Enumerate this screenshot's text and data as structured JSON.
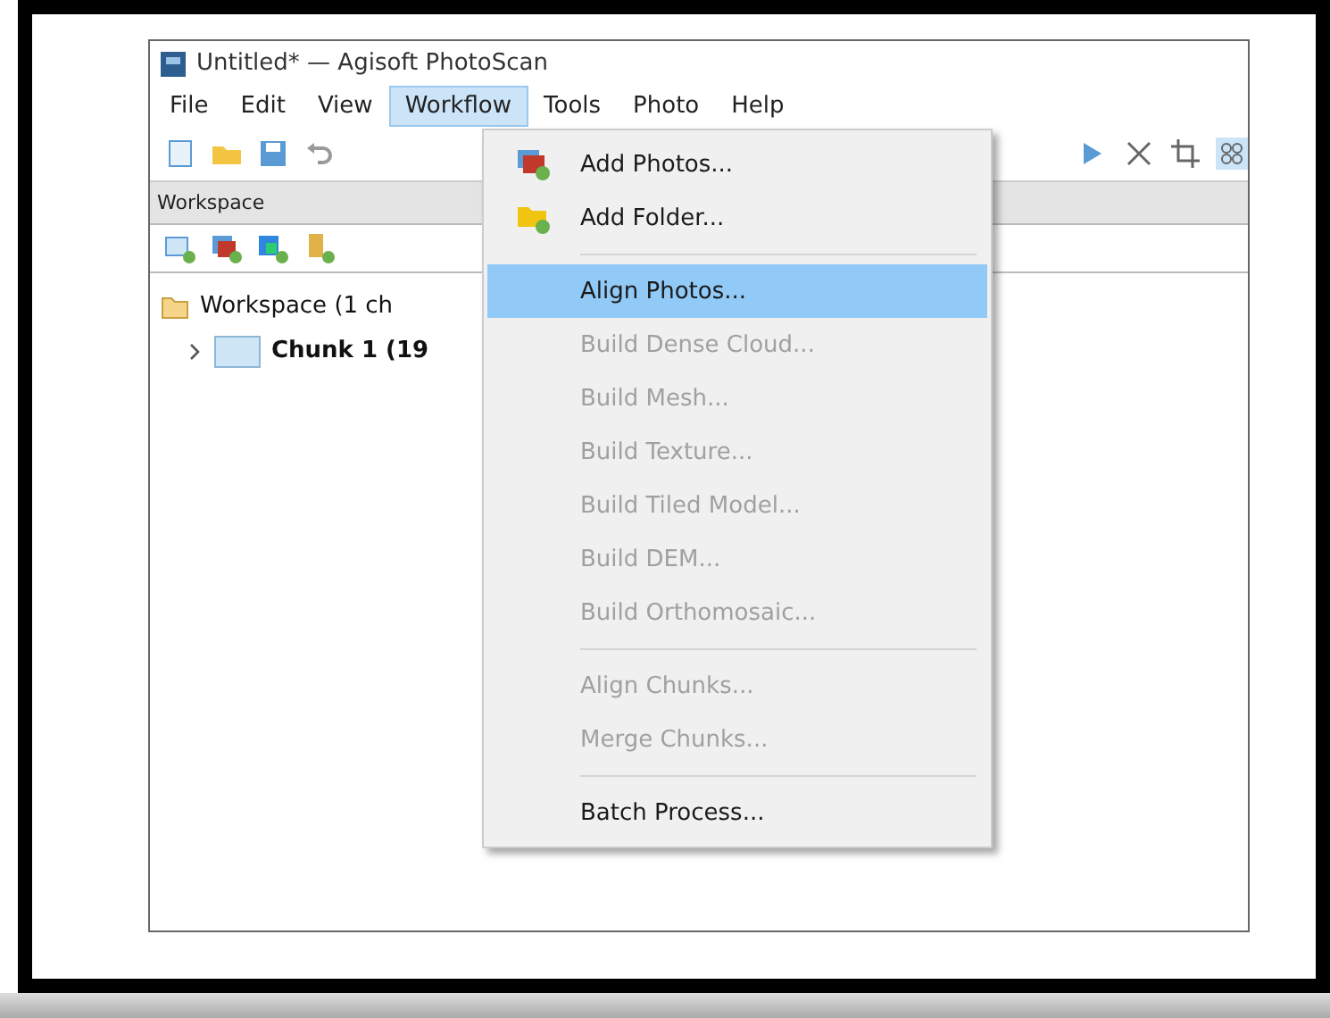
{
  "window": {
    "title": "Untitled* — Agisoft PhotoScan"
  },
  "menu_bar": [
    {
      "label": "File",
      "selected": false
    },
    {
      "label": "Edit",
      "selected": false
    },
    {
      "label": "View",
      "selected": false
    },
    {
      "label": "Workflow",
      "selected": true
    },
    {
      "label": "Tools",
      "selected": false
    },
    {
      "label": "Photo",
      "selected": false
    },
    {
      "label": "Help",
      "selected": false
    }
  ],
  "workspace": {
    "title": "Workspace",
    "tree": [
      {
        "label": "Workspace (1 ch",
        "children": [
          {
            "label": "Chunk 1 (19",
            "expanded": false
          }
        ]
      }
    ]
  },
  "workflow_menu": [
    {
      "kind": "icon-item",
      "label": "Add Photos...",
      "disabled": false,
      "selected": false
    },
    {
      "kind": "icon-item",
      "label": "Add Folder...",
      "disabled": false,
      "selected": false
    },
    {
      "kind": "separator"
    },
    {
      "kind": "item",
      "label": "Align Photos...",
      "disabled": false,
      "selected": true
    },
    {
      "kind": "item",
      "label": "Build Dense Cloud...",
      "disabled": true,
      "selected": false
    },
    {
      "kind": "item",
      "label": "Build Mesh...",
      "disabled": true,
      "selected": false
    },
    {
      "kind": "item",
      "label": "Build Texture...",
      "disabled": true,
      "selected": false
    },
    {
      "kind": "item",
      "label": "Build Tiled Model...",
      "disabled": true,
      "selected": false
    },
    {
      "kind": "item",
      "label": "Build DEM...",
      "disabled": true,
      "selected": false
    },
    {
      "kind": "item",
      "label": "Build Orthomosaic...",
      "disabled": true,
      "selected": false
    },
    {
      "kind": "separator"
    },
    {
      "kind": "item",
      "label": "Align Chunks...",
      "disabled": true,
      "selected": false
    },
    {
      "kind": "item",
      "label": "Merge Chunks...",
      "disabled": true,
      "selected": false
    },
    {
      "kind": "separator"
    },
    {
      "kind": "item",
      "label": "Batch Process...",
      "disabled": false,
      "selected": false
    }
  ]
}
